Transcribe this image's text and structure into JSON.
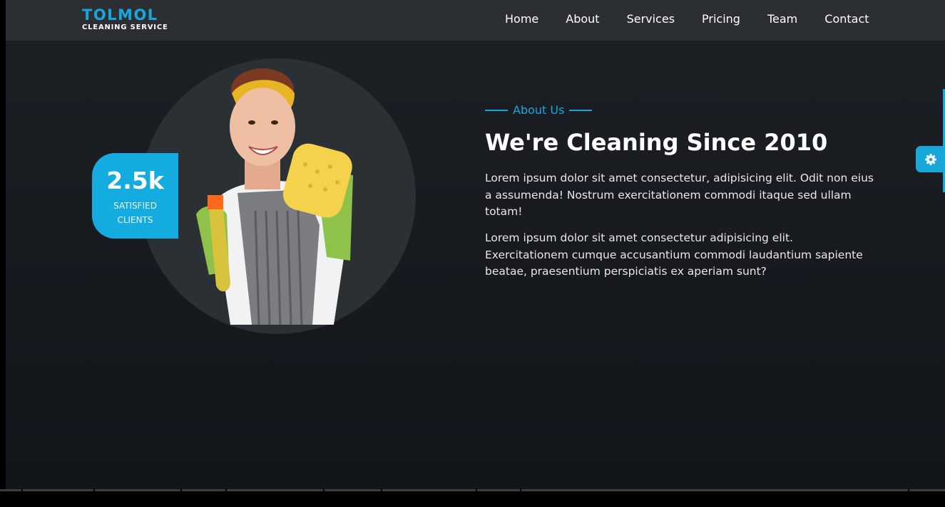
{
  "brand": {
    "name": "TOLMOL",
    "tagline": "CLEANING SERVICE"
  },
  "nav": {
    "items": [
      "Home",
      "About",
      "Services",
      "Pricing",
      "Team",
      "Contact"
    ]
  },
  "badge": {
    "value": "2.5k",
    "label_line1": "SATISFIED",
    "label_line2": "CLIENTS"
  },
  "about": {
    "eyebrow": "About Us",
    "heading": "We're Cleaning Since 2010",
    "paragraph1": "Lorem ipsum dolor sit amet consectetur, adipisicing elit. Odit non eius a assumenda! Nostrum exercitationem commodi itaque sed ullam totam!",
    "paragraph2": "Lorem ipsum dolor sit amet consectetur adipisicing elit. Exercitationem cumque accusantium commodi laudantium sapiente beatae, praesentium perspiciatis ex aperiam sunt?"
  },
  "icons": {
    "settings": "gear-icon"
  },
  "colors": {
    "accent": "#18a7da",
    "navbar": "#2b2f34",
    "background": "#1a1e23"
  }
}
